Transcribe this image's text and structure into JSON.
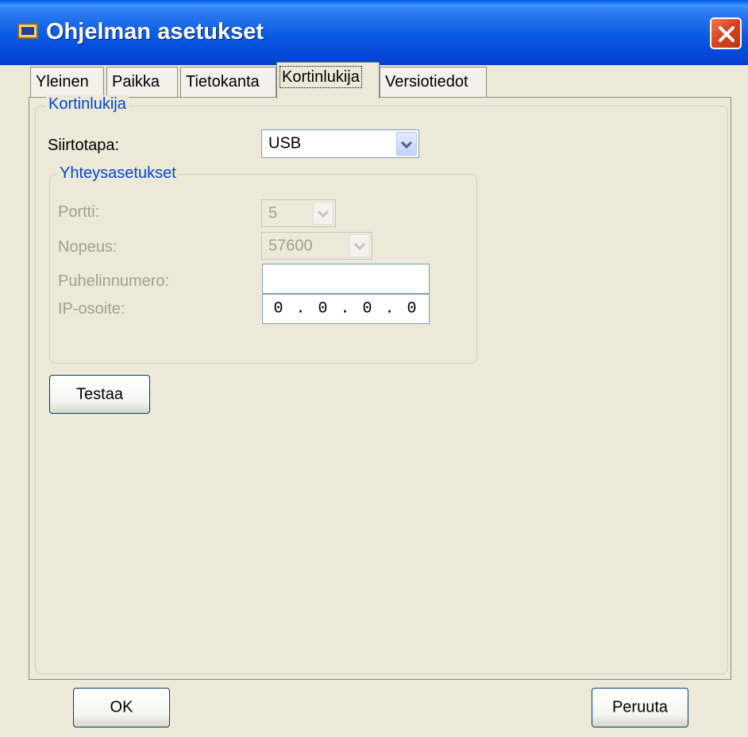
{
  "window": {
    "title": "Ohjelman asetukset",
    "close_icon": "close-icon",
    "app_icon": "app-icon"
  },
  "tabs": [
    {
      "label": "Yleinen"
    },
    {
      "label": "Paikka"
    },
    {
      "label": "Tietokanta"
    },
    {
      "label": "Kortinlukija",
      "active": true
    },
    {
      "label": "Versiotiedot"
    }
  ],
  "reader": {
    "group_label": "Kortinlukija",
    "transfer_label": "Siirtotapa:",
    "transfer_value": "USB",
    "connection": {
      "group_label": "Yhteysasetukset",
      "port_label": "Portti:",
      "port_value": "5",
      "speed_label": "Nopeus:",
      "speed_value": "57600",
      "phone_label": "Puhelinnumero:",
      "phone_value": "",
      "ip_label": "IP-osoite:",
      "ip_value": "0 . 0 . 0 . 0"
    },
    "test_button": "Testaa"
  },
  "footer": {
    "ok_label": "OK",
    "cancel_label": "Peruuta"
  },
  "colors": {
    "titlebar": "#0a5ae2",
    "group_label": "#0046d5",
    "disabled_text": "#a0a08f",
    "close_button": "#d8421c"
  }
}
